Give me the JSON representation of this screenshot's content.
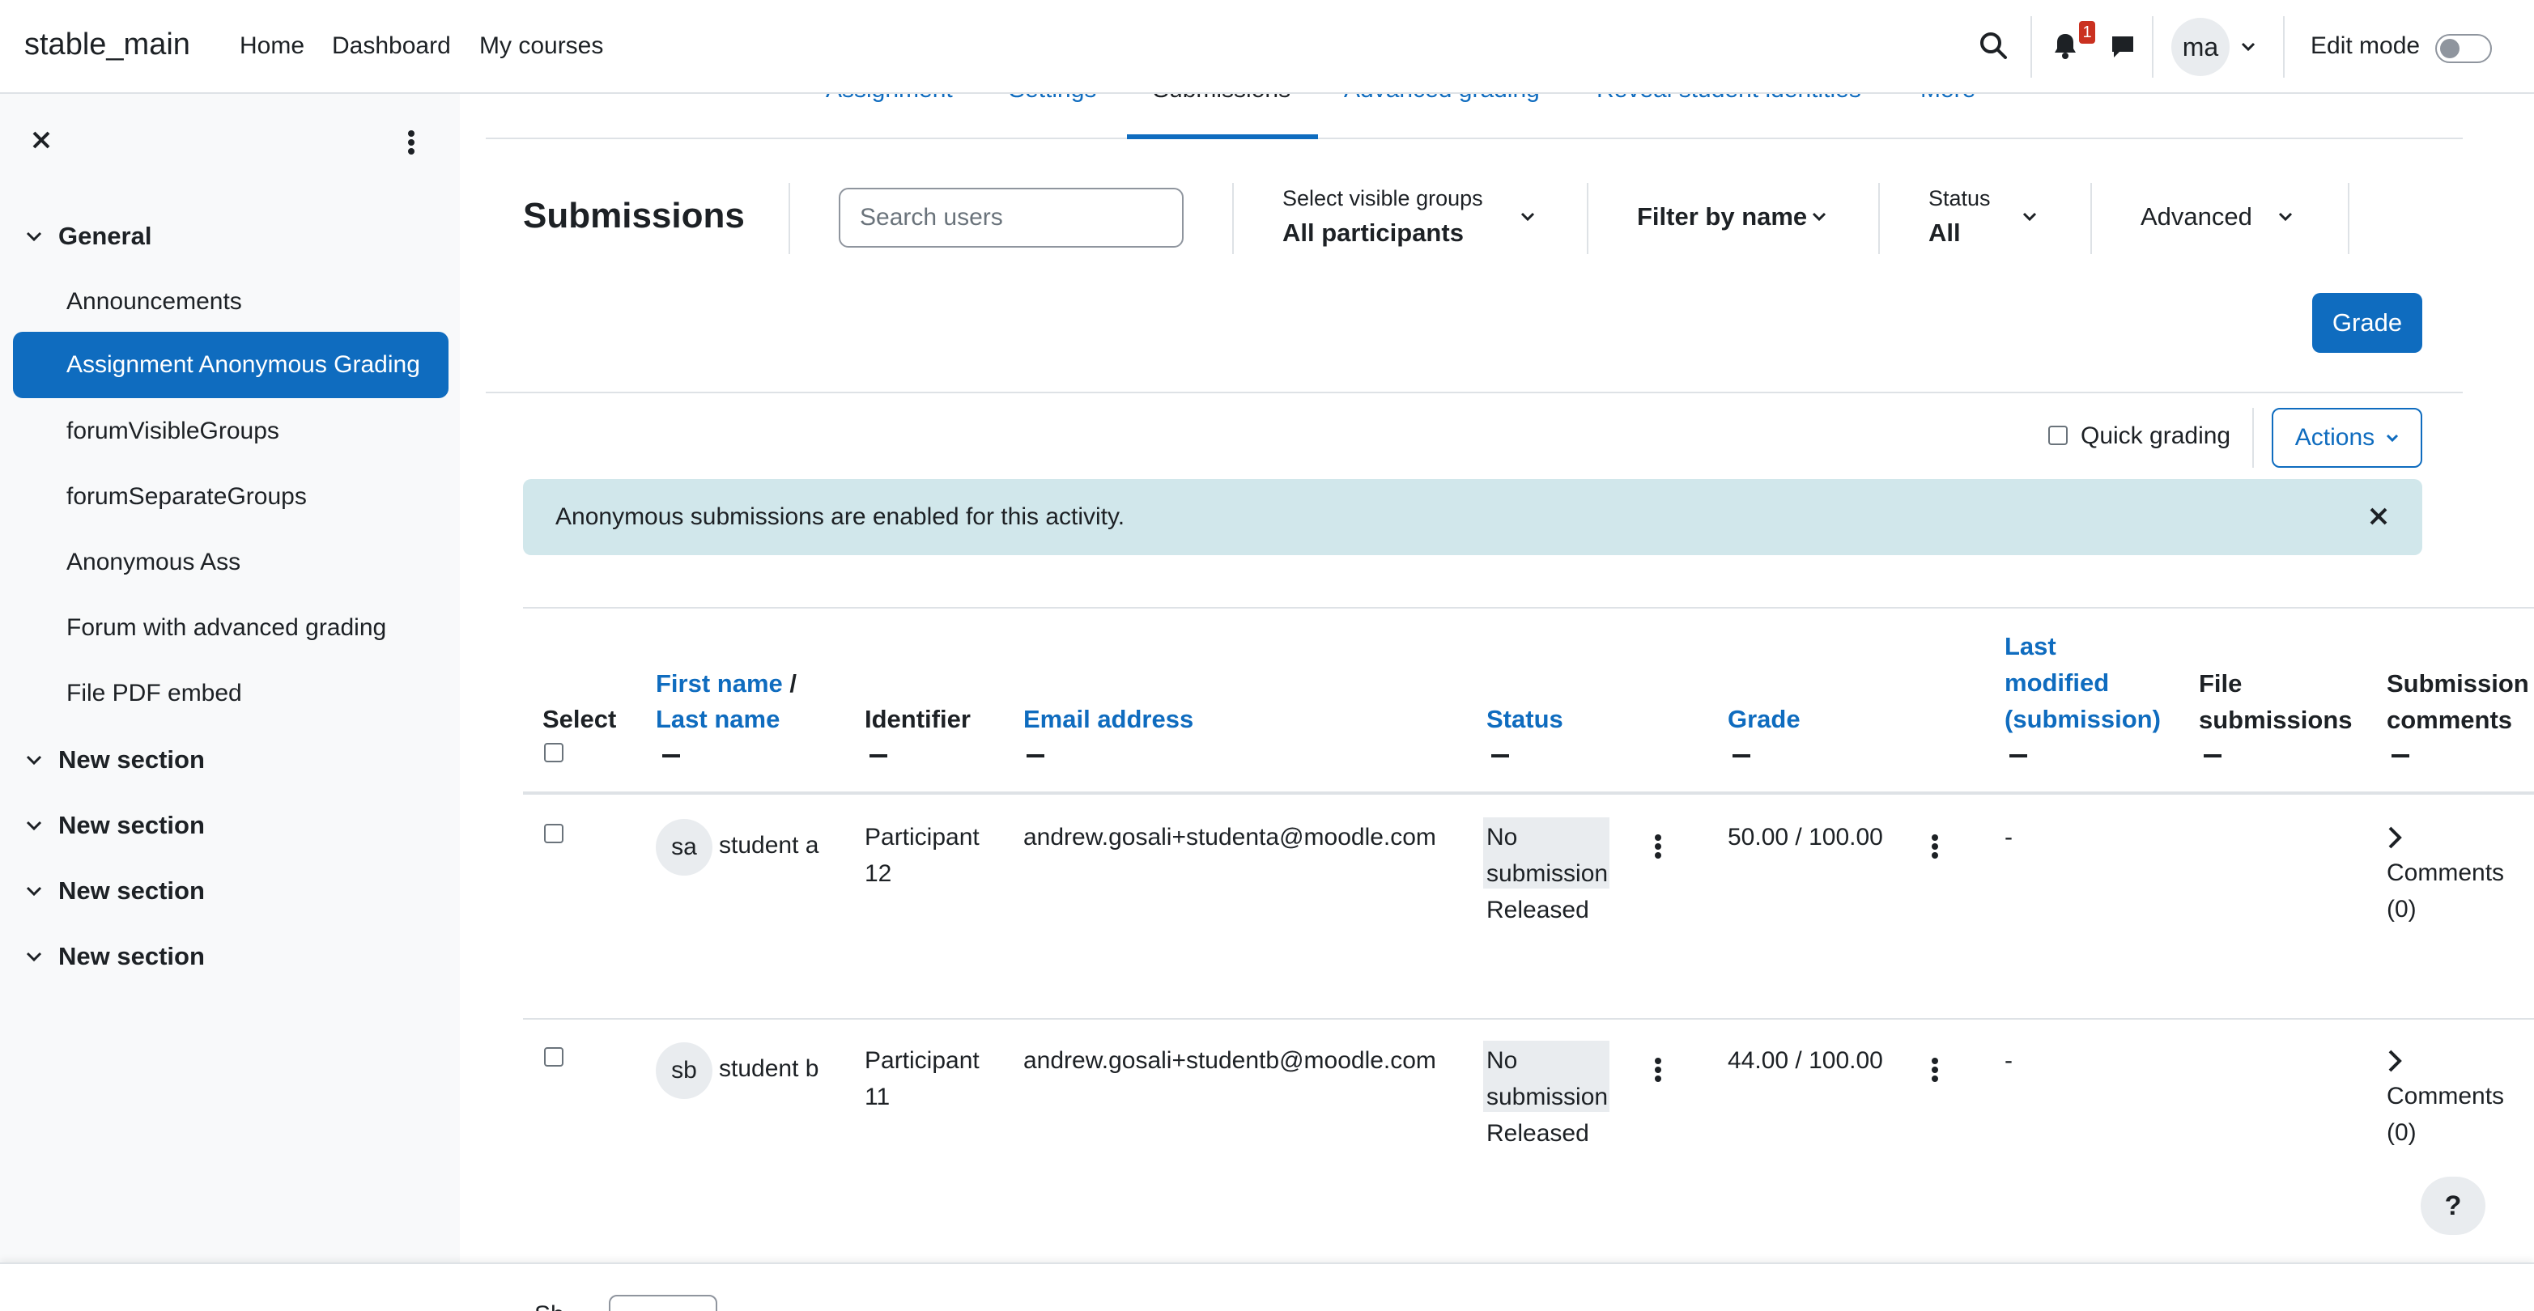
{
  "navbar": {
    "brand": "stable_main",
    "links": [
      "Home",
      "Dashboard",
      "My courses"
    ],
    "notification_count": "1",
    "user_initials": "ma",
    "edit_mode_label": "Edit mode",
    "edit_mode_on": false
  },
  "drawer": {
    "sections": [
      {
        "title": "General",
        "expanded": true
      },
      {
        "title": "New section",
        "expanded": true
      },
      {
        "title": "New section",
        "expanded": true
      },
      {
        "title": "New section",
        "expanded": true
      },
      {
        "title": "New section",
        "expanded": true
      }
    ],
    "activities": [
      "Announcements",
      "Assignment Anonymous Grading",
      "forumVisibleGroups",
      "forumSeparateGroups",
      "Anonymous Ass",
      "Forum with advanced grading",
      "File PDF embed"
    ],
    "active_activity": "Assignment Anonymous Grading"
  },
  "tabs": [
    "Assignment",
    "Settings",
    "Submissions",
    "Advanced grading",
    "Reveal student identities",
    "More"
  ],
  "active_tab": "Submissions",
  "toolbar": {
    "title": "Submissions",
    "search_placeholder": "Search users",
    "groups_label": "Select visible groups",
    "groups_value": "All participants",
    "filter_by_name": "Filter by name",
    "status_label": "Status",
    "status_value": "All",
    "advanced": "Advanced",
    "grade_button": "Grade"
  },
  "quick_grading_label": "Quick grading",
  "actions_label": "Actions",
  "alert_text": "Anonymous submissions are enabled for this activity.",
  "table": {
    "headers": {
      "select": "Select",
      "first_name": "First name",
      "slash": "/",
      "last_name": "Last name",
      "identifier": "Identifier",
      "email": "Email address",
      "status": "Status",
      "grade": "Grade",
      "last_modified_1": "Last",
      "last_modified_2": "modified",
      "last_modified_3": "(submission)",
      "file_1": "File",
      "file_2": "submissions",
      "comments_1": "Submission",
      "comments_2": "comments"
    },
    "rows": [
      {
        "initials": "sa",
        "name": "student a",
        "identifier_1": "Participant",
        "identifier_2": "12",
        "email": "andrew.gosali+studenta@moodle.com",
        "status_1": "No",
        "status_2": "submission",
        "status_3": "Released",
        "grade": "50.00 / 100.00",
        "last_modified": "-",
        "comments_1": "Comments",
        "comments_2": "(0)"
      },
      {
        "initials": "sb",
        "name": "student b",
        "identifier_1": "Participant",
        "identifier_2": "11",
        "email": "andrew.gosali+studentb@moodle.com",
        "status_1": "No",
        "status_2": "submission",
        "status_3": "Released",
        "grade": "44.00 / 100.00",
        "last_modified": "-",
        "comments_1": "Comments",
        "comments_2": "(0)"
      }
    ]
  },
  "help_label": "?",
  "footer_label": "Sh",
  "colors": {
    "primary": "#0f6cbf",
    "alert_bg": "#d1e7eb",
    "drawer_bg": "#f8f9fa",
    "badge": "#ca3120"
  }
}
